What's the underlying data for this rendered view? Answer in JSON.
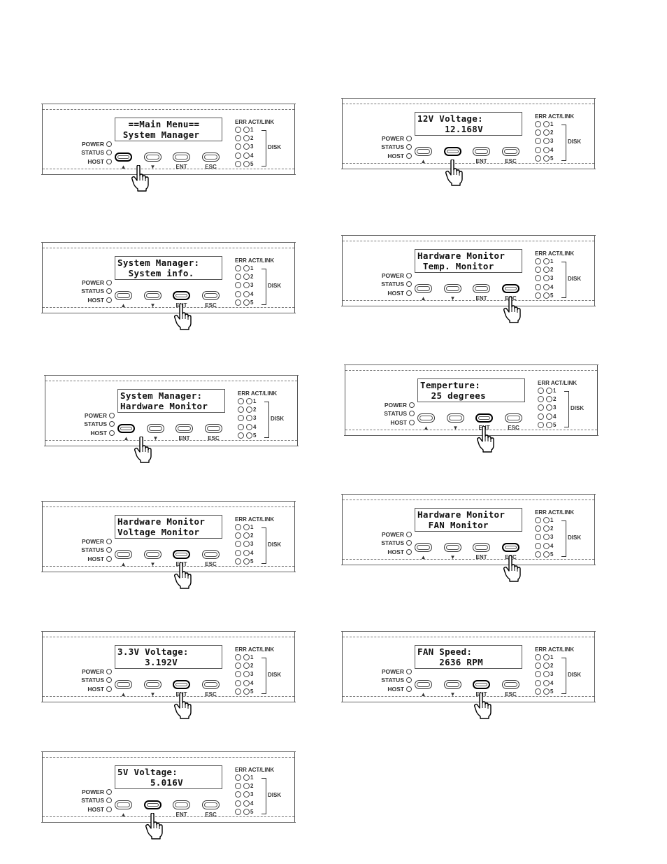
{
  "common": {
    "left_leds": [
      "POWER",
      "STATUS",
      "HOST"
    ],
    "buttons": [
      {
        "id": "up",
        "label": "▲"
      },
      {
        "id": "down",
        "label": "▼"
      },
      {
        "id": "ent",
        "label": "ENT"
      },
      {
        "id": "esc",
        "label": "ESC"
      }
    ],
    "disk_header": "ERR ACT/LINK",
    "disk_numbers": [
      "1",
      "2",
      "3",
      "4",
      "5"
    ],
    "disk_label": "DISK"
  },
  "panels": [
    {
      "step": "main-menu",
      "line1": "  ==Main Menu==",
      "line2": " System Manager",
      "pressed": "up"
    },
    {
      "step": "system-info",
      "line1": "System Manager:",
      "line2": "  System info.",
      "pressed": "ent"
    },
    {
      "step": "hardware-monitor",
      "line1": "System Manager:",
      "line2": "Hardware Monitor",
      "pressed": "up"
    },
    {
      "step": "voltage-monitor",
      "line1": "Hardware Monitor",
      "line2": "Voltage Monitor",
      "pressed": "ent"
    },
    {
      "step": "voltage-3v3",
      "line1": "3.3V Voltage:",
      "line2": "     3.192V",
      "pressed": "ent"
    },
    {
      "step": "voltage-5v",
      "line1": "5V Voltage:",
      "line2": "      5.016V",
      "pressed": "down"
    },
    {
      "step": "voltage-12v",
      "line1": "12V Voltage:",
      "line2": "     12.168V",
      "pressed": "down"
    },
    {
      "step": "temp-monitor",
      "line1": "Hardware Monitor",
      "line2": " Temp. Monitor",
      "pressed": "esc"
    },
    {
      "step": "temperature",
      "line1": "Temperture:",
      "line2": "  25 degrees",
      "pressed": "ent"
    },
    {
      "step": "fan-monitor",
      "line1": "Hardware Monitor",
      "line2": "  FAN Monitor",
      "pressed": "esc"
    },
    {
      "step": "fan-speed",
      "line1": "FAN Speed:",
      "line2": "    2636 RPM",
      "pressed": "ent"
    }
  ]
}
